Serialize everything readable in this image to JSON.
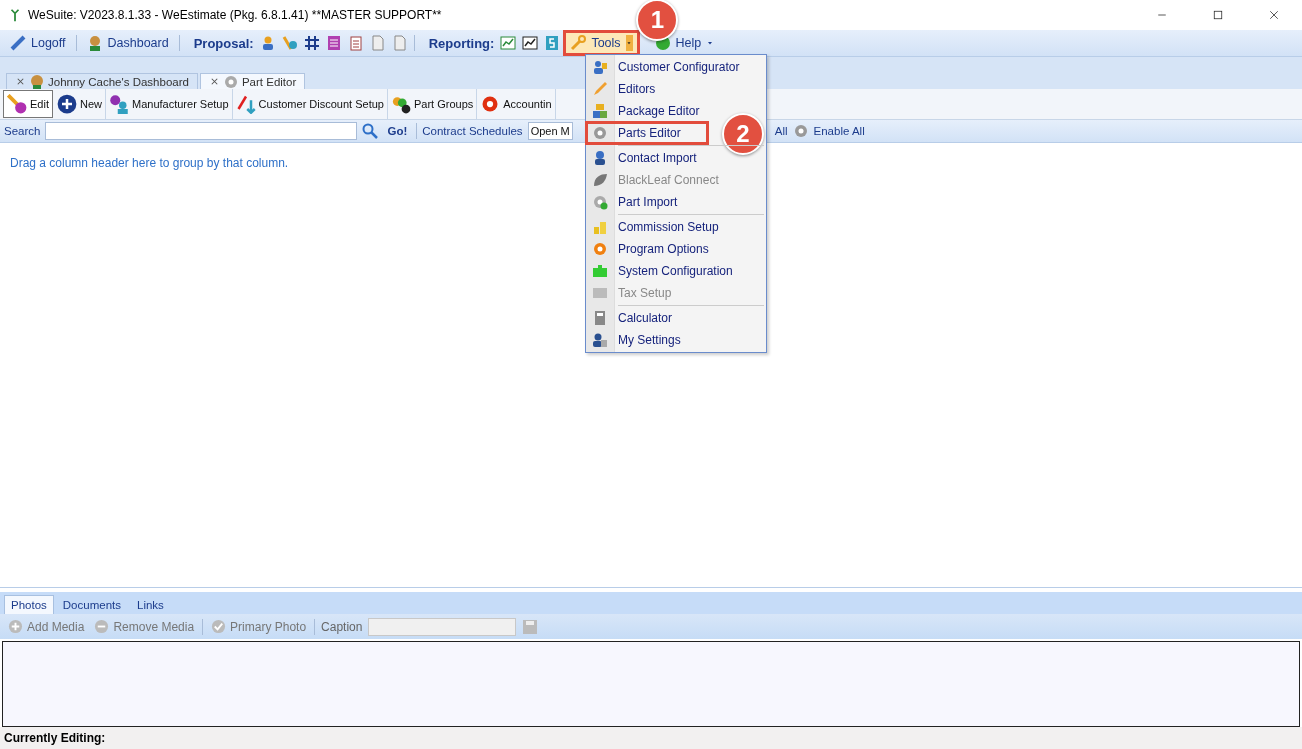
{
  "window": {
    "title": "WeSuite: V2023.8.1.33 - WeEstimate (Pkg. 6.8.1.41) **MASTER SUPPORT**"
  },
  "toolbar": {
    "buttons": [
      {
        "label": "Logoff"
      },
      {
        "label": "Dashboard"
      }
    ],
    "proposal_label": "Proposal:",
    "reporting_label": "Reporting:",
    "tools_button": {
      "label": "Tools",
      "expanded": true,
      "callout": "1"
    },
    "help_button": {
      "label": "Help"
    }
  },
  "document_tabs": [
    {
      "label": "Johnny Cache's Dashboard",
      "selected": false
    },
    {
      "label": "Part Editor",
      "selected": true
    }
  ],
  "ribbon": [
    {
      "label": "Edit",
      "selected": true
    },
    {
      "label": "New",
      "selected": false
    },
    {
      "label": "Manufacturer Setup",
      "selected": false
    },
    {
      "label": "Customer Discount Setup",
      "selected": false
    },
    {
      "label": "Part Groups",
      "selected": false
    },
    {
      "label": "Accountin",
      "selected": false
    }
  ],
  "search_bar": {
    "label": "Search",
    "go": "Go!",
    "contract_label": "Contract Schedules",
    "dropdown_value": "Open M",
    "trailing": "All",
    "enable_all": "Enable All"
  },
  "grid": {
    "group_hint": "Drag a column header here to group by that column."
  },
  "tools_menu": {
    "items": [
      {
        "label": "Customer Configurator",
        "disabled": false,
        "separator_before": false
      },
      {
        "label": "Editors",
        "disabled": false,
        "separator_before": false
      },
      {
        "label": "Package Editor",
        "disabled": false,
        "separator_before": false
      },
      {
        "label": "Parts Editor",
        "disabled": false,
        "separator_before": false,
        "callout": "2"
      },
      {
        "label": "Contact Import",
        "disabled": false,
        "separator_before": true
      },
      {
        "label": "BlackLeaf Connect",
        "disabled": true,
        "separator_before": false
      },
      {
        "label": "Part Import",
        "disabled": false,
        "separator_before": false
      },
      {
        "label": "Commission Setup",
        "disabled": false,
        "separator_before": true
      },
      {
        "label": "Program Options",
        "disabled": false,
        "separator_before": false
      },
      {
        "label": "System Configuration",
        "disabled": false,
        "separator_before": false
      },
      {
        "label": "Tax Setup",
        "disabled": true,
        "separator_before": false
      },
      {
        "label": "Calculator",
        "disabled": false,
        "separator_before": true
      },
      {
        "label": "My Settings",
        "disabled": false,
        "separator_before": false
      }
    ]
  },
  "bottom_tabs": [
    {
      "label": "Photos",
      "selected": true
    },
    {
      "label": "Documents",
      "selected": false
    },
    {
      "label": "Links",
      "selected": false
    }
  ],
  "media_toolbar": {
    "buttons": [
      {
        "label": "Add Media",
        "disabled": true
      },
      {
        "label": "Remove Media",
        "disabled": true
      },
      {
        "label": "Primary Photo",
        "disabled": true
      }
    ],
    "caption_label": "Caption"
  },
  "status_bar": {
    "label": "Currently Editing:"
  }
}
